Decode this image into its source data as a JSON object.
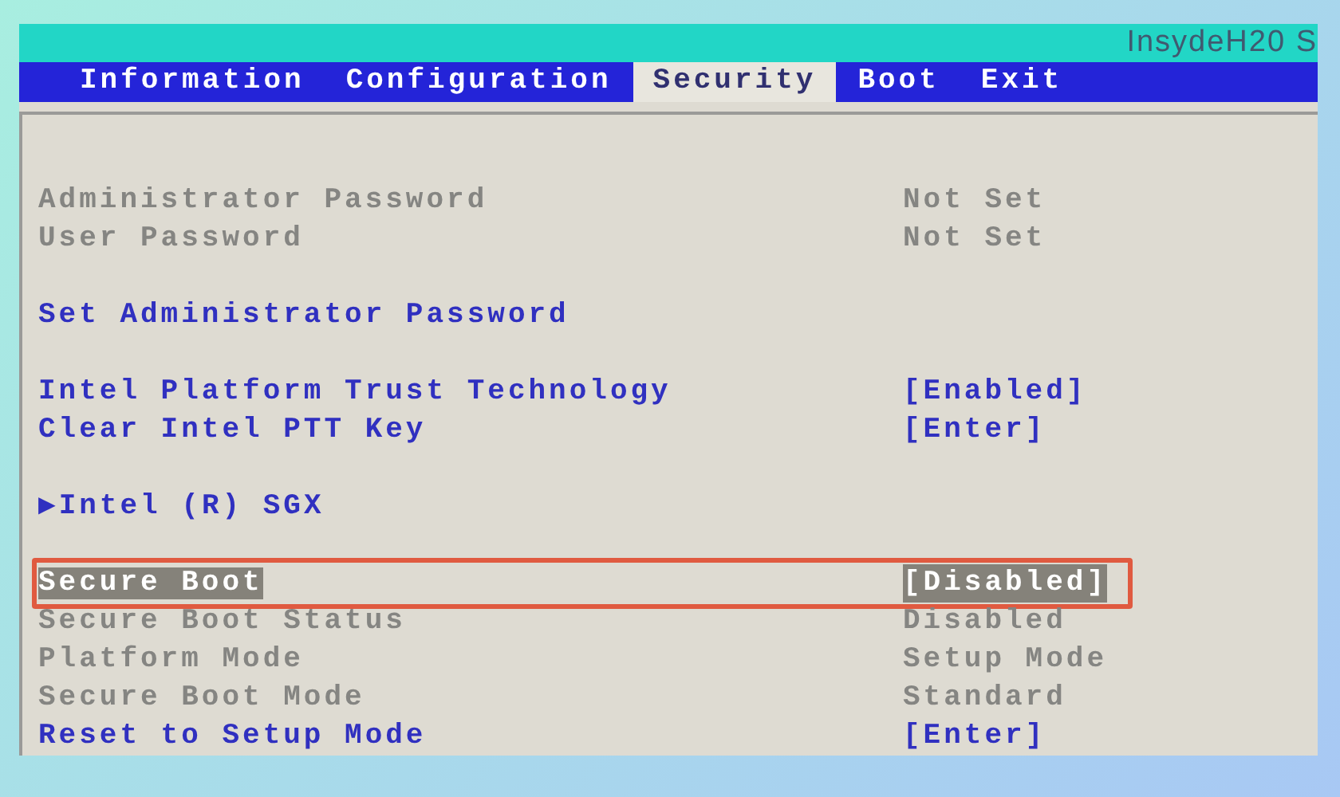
{
  "header": {
    "brand": "InsydeH20 S"
  },
  "tabs": [
    {
      "label": "Information",
      "selected": false
    },
    {
      "label": "Configuration",
      "selected": false
    },
    {
      "label": "Security",
      "selected": true
    },
    {
      "label": "Boot",
      "selected": false
    },
    {
      "label": "Exit",
      "selected": false
    }
  ],
  "groups": [
    {
      "items": [
        {
          "kind": "static",
          "label": "Administrator Password",
          "value": "Not Set",
          "selected": false
        },
        {
          "kind": "static",
          "label": "User Password",
          "value": "Not Set",
          "selected": false
        }
      ]
    },
    {
      "items": [
        {
          "kind": "option",
          "label": "Set Administrator Password",
          "selected": false
        }
      ]
    },
    {
      "items": [
        {
          "kind": "option",
          "label": "Intel Platform Trust Technology",
          "value": "[Enabled]",
          "selected": false
        },
        {
          "kind": "option",
          "label": "Clear Intel PTT Key",
          "value": "[Enter]",
          "selected": false
        }
      ]
    },
    {
      "items": [
        {
          "kind": "submenu",
          "marker": "▶",
          "label": "Intel (R) SGX",
          "selected": false
        }
      ]
    },
    {
      "items": [
        {
          "kind": "option",
          "label": "Secure Boot",
          "value": "[Disabled]",
          "selected": true
        },
        {
          "kind": "static",
          "label": "Secure Boot Status",
          "value": "Disabled",
          "selected": false
        },
        {
          "kind": "static",
          "label": "Platform Mode",
          "value": "Setup Mode",
          "selected": false
        },
        {
          "kind": "static",
          "label": "Secure Boot Mode",
          "value": "Standard",
          "selected": false
        },
        {
          "kind": "option",
          "label": "Reset to Setup Mode",
          "value": "[Enter]",
          "selected": false
        }
      ]
    }
  ]
}
